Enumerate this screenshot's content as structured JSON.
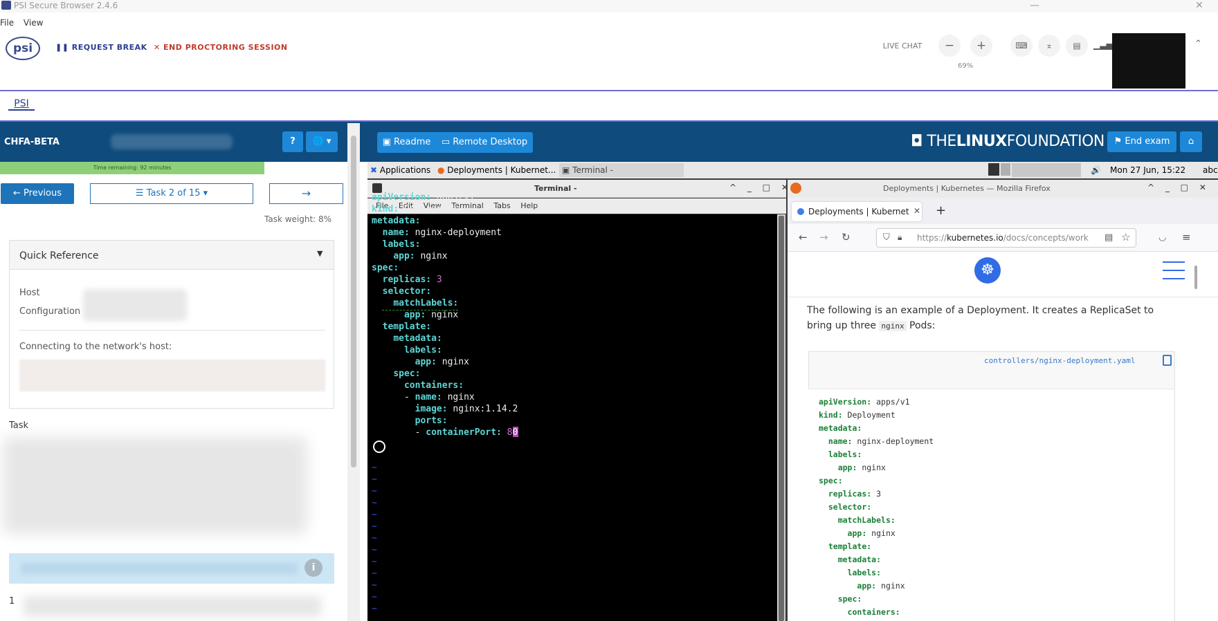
{
  "window": {
    "title": "PSI Secure Browser 2.4.6",
    "minimize": "—",
    "close": "✕",
    "menu": [
      "File",
      "View"
    ]
  },
  "proctor": {
    "logo": "psi",
    "request_break": "REQUEST BREAK",
    "end_session": "END PROCTORING SESSION",
    "live_chat": "LIVE CHAT",
    "zoom_out": "−",
    "zoom_in": "+",
    "zoom_level": "69%",
    "collapse": "⌃",
    "tab_label": "PSI"
  },
  "exam": {
    "code": "CHFA-BETA",
    "help": "?",
    "language": "🌐 ▾",
    "readme_label": "Readme",
    "remote_label": "Remote Desktop",
    "brand_pre": "THE",
    "brand_bold": "LINUX",
    "brand_post": "FOUNDATION",
    "end_exam": "End exam",
    "home": "⌂"
  },
  "left": {
    "time_remaining": "Time remaining: 92 minutes",
    "previous": "← Previous",
    "task_select": "☰ Task 2 of 15 ▾",
    "next": "→",
    "task_weight": "Task weight: 8%",
    "quick_reference": "Quick Reference",
    "qr_caret": "▼",
    "host_label": "Host",
    "config_label": "Configuration",
    "connect_text": "Connecting to the network's host:",
    "task_heading": "Task",
    "info_icon": "i",
    "step_number": "1"
  },
  "desktop": {
    "applications": "Applications",
    "firefox_task": "Deployments | Kubernet...",
    "terminal_task": "Terminal -",
    "clock": "Mon 27 Jun, 15:22",
    "kbd": "abc",
    "volume": "🔊"
  },
  "terminal": {
    "title": "Terminal -",
    "controls": "^ _ □ ✕",
    "menu": [
      "File",
      "Edit",
      "View",
      "Terminal",
      "Tabs",
      "Help"
    ],
    "lines": [
      {
        "key": "apiVersion",
        "val": " apps/v1",
        "indent": ""
      },
      {
        "key": "kind",
        "val": " Deployment",
        "indent": ""
      },
      {
        "key": "metadata",
        "val": "",
        "indent": ""
      },
      {
        "key": "name",
        "val": " nginx-deployment",
        "indent": "  "
      },
      {
        "key": "labels",
        "val": "",
        "indent": "  "
      },
      {
        "key": "app",
        "val": " nginx",
        "indent": "    "
      },
      {
        "key": "spec",
        "val": "",
        "indent": ""
      },
      {
        "key": "replicas",
        "val": " 3",
        "indent": "  ",
        "num": true
      },
      {
        "key": "selector",
        "val": "",
        "indent": "  "
      },
      {
        "key": "matchLabels",
        "val": "",
        "indent": "    "
      },
      {
        "key": "app",
        "val": " nginx",
        "indent": "      "
      },
      {
        "key": "template",
        "val": "",
        "indent": "  "
      },
      {
        "key": "metadata",
        "val": "",
        "indent": "    "
      },
      {
        "key": "labels",
        "val": "",
        "indent": "      "
      },
      {
        "key": "app",
        "val": " nginx",
        "indent": "        "
      },
      {
        "key": "spec",
        "val": "",
        "indent": "    "
      },
      {
        "key": "containers",
        "val": "",
        "indent": "      "
      },
      {
        "key": "name",
        "val": " nginx",
        "indent": "      - "
      },
      {
        "key": "image",
        "val": " nginx:1.14.2",
        "indent": "        "
      },
      {
        "key": "ports",
        "val": "",
        "indent": "        "
      },
      {
        "key": "containerPort",
        "val": " 8",
        "indent": "        - ",
        "num": true,
        "cursor": "0"
      }
    ],
    "tildes": "~\n~\n~\n~\n~\n~\n~\n~\n~\n~\n~\n~\n~"
  },
  "firefox": {
    "title": "Deployments | Kubernetes — Mozilla Firefox",
    "controls": "^ _ □ ✕",
    "tab_label": "Deployments | Kubernet",
    "tab_close": "✕",
    "new_tab": "+",
    "url_prefix": "https://",
    "url_host": "kubernetes.io",
    "url_path": "/docs/concepts/work",
    "doc_text_1": "The following is an example of a Deployment. It creates a ReplicaSet to bring up three ",
    "doc_code": "nginx",
    "doc_text_2": " Pods:",
    "file_name": "controllers/nginx-deployment.yaml",
    "code": [
      {
        "key": "apiVersion",
        "val": " apps/v1",
        "indent": ""
      },
      {
        "key": "kind",
        "val": " Deployment",
        "indent": ""
      },
      {
        "key": "metadata",
        "val": "",
        "indent": ""
      },
      {
        "key": "name",
        "val": " nginx-deployment",
        "indent": "  "
      },
      {
        "key": "labels",
        "val": "",
        "indent": "  "
      },
      {
        "key": "app",
        "val": " nginx",
        "indent": "    "
      },
      {
        "key": "spec",
        "val": "",
        "indent": ""
      },
      {
        "key": "replicas",
        "val": " 3",
        "indent": "  "
      },
      {
        "key": "selector",
        "val": "",
        "indent": "  "
      },
      {
        "key": "matchLabels",
        "val": "",
        "indent": "    "
      },
      {
        "key": "app",
        "val": " nginx",
        "indent": "      "
      },
      {
        "key": "template",
        "val": "",
        "indent": "  "
      },
      {
        "key": "metadata",
        "val": "",
        "indent": "    "
      },
      {
        "key": "labels",
        "val": "",
        "indent": "      "
      },
      {
        "key": "app",
        "val": " nginx",
        "indent": "        "
      },
      {
        "key": "spec",
        "val": "",
        "indent": "    "
      },
      {
        "key": "containers",
        "val": "",
        "indent": "      "
      }
    ]
  },
  "colors": {
    "exam_header": "#0f4b7c",
    "accent_blue": "#1e88d8",
    "terminal_key": "#5fd7d7",
    "terminal_number": "#d070d0",
    "k8s_blue": "#326ce5"
  }
}
